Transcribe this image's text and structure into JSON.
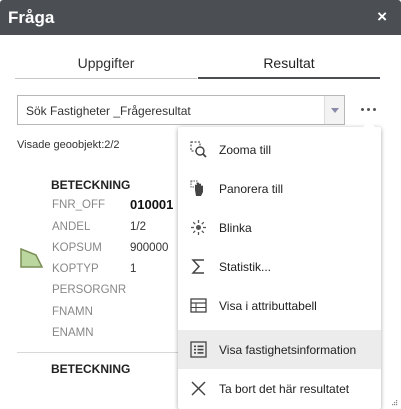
{
  "window": {
    "title": "Fråga",
    "close_symbol": "×"
  },
  "tabs": [
    {
      "label": "Uppgifter",
      "active": false
    },
    {
      "label": "Resultat",
      "active": true
    }
  ],
  "layer_select": {
    "selected": "Sök Fastigheter _Frågeresultat"
  },
  "result_count": "Visade geoobjekt:2/2",
  "features": [
    {
      "heading": "BETECKNING",
      "fields": [
        {
          "key": "FNR_OFF",
          "value": "010001"
        },
        {
          "key": "ANDEL",
          "value": "1/2"
        },
        {
          "key": "KOPSUM",
          "value": "900000"
        },
        {
          "key": "KOPTYP",
          "value": "1"
        },
        {
          "key": "PERSORGNR",
          "value": ""
        },
        {
          "key": "FNAMN",
          "value": ""
        },
        {
          "key": "ENAMN",
          "value": ""
        }
      ]
    },
    {
      "heading": "BETECKNING"
    }
  ],
  "menu": {
    "items": [
      {
        "label": "Zooma till",
        "icon": "zoom-to-icon"
      },
      {
        "label": "Panorera till",
        "icon": "pan-hand-icon"
      },
      {
        "label": "Blinka",
        "icon": "flash-icon"
      },
      {
        "label": "Statistik...",
        "icon": "sigma-icon"
      },
      {
        "label": "Visa i attributtabell",
        "icon": "table-icon"
      },
      {
        "label": "Visa fastighetsinformation",
        "icon": "list-icon",
        "highlighted": true
      },
      {
        "label": "Ta bort det här resultatet",
        "icon": "remove-x-icon"
      }
    ]
  },
  "colors": {
    "titlebar": "#4b4f54",
    "polygon_fill": "#bcd6a0",
    "polygon_stroke": "#7a8f55",
    "menu_highlight": "#ececec"
  }
}
